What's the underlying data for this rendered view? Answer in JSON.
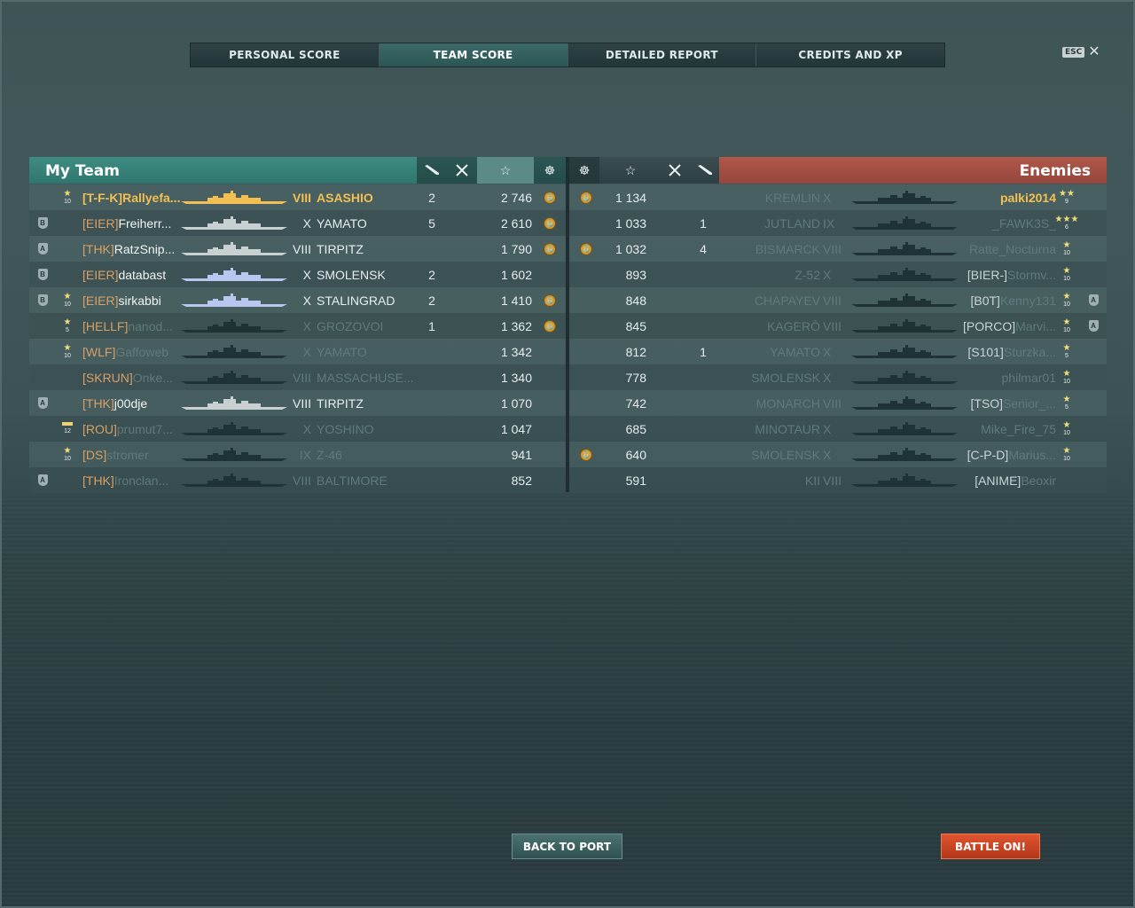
{
  "tabs": [
    {
      "label": "PERSONAL SCORE",
      "active": false
    },
    {
      "label": "TEAM SCORE",
      "active": true
    },
    {
      "label": "DETAILED REPORT",
      "active": false
    },
    {
      "label": "CREDITS AND XP",
      "active": false
    }
  ],
  "esc": {
    "key": "ESC",
    "close": "✕"
  },
  "my_team": {
    "title": "My Team",
    "header_icons": [
      "torpedo-icon",
      "planes-shot-icon",
      "star-icon",
      "anchor-medal-icon"
    ]
  },
  "enemies": {
    "title": "Enemies",
    "header_icons": [
      "anchor-medal-icon",
      "star-icon",
      "planes-shot-icon",
      "torpedo-icon"
    ]
  },
  "rows": [
    {
      "left": {
        "badge": "",
        "rank": "10",
        "rank_type": "star",
        "clan": "[T-F-K]",
        "player": "Rallyefa...",
        "player_dim": false,
        "tier": "VIII",
        "ship": "ASASHIO",
        "ship_dim": false,
        "kills": "2",
        "exp": "2 746",
        "medal": true,
        "me": true,
        "silhouette": "#f2c052"
      },
      "right": {
        "medal": true,
        "exp": "1 134",
        "kills": "",
        "ship": "KREMLIN",
        "tier": "X",
        "clan": "",
        "player": "palki2014",
        "rank": "9",
        "rank_type": "stars2",
        "badge": ""
      }
    },
    {
      "left": {
        "badge": "B",
        "rank": "",
        "rank_type": "",
        "clan": "[EIER]",
        "player": "Freiherr...",
        "player_dim": false,
        "tier": "X",
        "ship": "YAMATO",
        "ship_dim": false,
        "kills": "5",
        "exp": "2 610",
        "medal": true,
        "me": false,
        "silhouette": "#c8d0d2"
      },
      "right": {
        "medal": false,
        "exp": "1 033",
        "kills": "1",
        "ship": "JUTLAND",
        "tier": "IX",
        "clan": "",
        "player": "_FAWK3S_",
        "rank": "6",
        "rank_type": "stars3",
        "badge": ""
      }
    },
    {
      "left": {
        "badge": "A",
        "rank": "",
        "rank_type": "",
        "clan": "[THK]",
        "player": "RatzSnip...",
        "player_dim": false,
        "tier": "VIII",
        "ship": "TIRPITZ",
        "ship_dim": false,
        "kills": "",
        "exp": "1 790",
        "medal": true,
        "me": false,
        "silhouette": "#c8d0d2"
      },
      "right": {
        "medal": true,
        "exp": "1 032",
        "kills": "4",
        "ship": "BISMARCK",
        "tier": "VIII",
        "clan": "",
        "player": "Ratte_Nocturna",
        "rank": "10",
        "rank_type": "star",
        "badge": ""
      }
    },
    {
      "left": {
        "badge": "B",
        "rank": "",
        "rank_type": "",
        "clan": "[EIER]",
        "player": "databast",
        "player_dim": false,
        "tier": "X",
        "ship": "SMOLENSK",
        "ship_dim": false,
        "kills": "2",
        "exp": "1 602",
        "medal": false,
        "me": false,
        "silhouette": "#b9c6f0"
      },
      "right": {
        "medal": false,
        "exp": "893",
        "kills": "",
        "ship": "Z-52",
        "tier": "X",
        "clan": "[BIER-]",
        "player": "Stormv...",
        "rank": "10",
        "rank_type": "star",
        "badge": ""
      }
    },
    {
      "left": {
        "badge": "B",
        "rank": "10",
        "rank_type": "star",
        "clan": "[EIER]",
        "player": "sirkabbi",
        "player_dim": false,
        "tier": "X",
        "ship": "STALINGRAD",
        "ship_dim": false,
        "kills": "2",
        "exp": "1 410",
        "medal": true,
        "me": false,
        "silhouette": "#b9c6f0"
      },
      "right": {
        "medal": false,
        "exp": "848",
        "kills": "",
        "ship": "CHAPAYEV",
        "tier": "VIII",
        "clan": "[B0T]",
        "player": "Kenny131",
        "rank": "10",
        "rank_type": "star",
        "badge": "A"
      }
    },
    {
      "left": {
        "badge": "",
        "rank": "5",
        "rank_type": "star",
        "clan": "[HELLF]",
        "player": "nanod...",
        "player_dim": true,
        "tier": "X",
        "ship": "GROZOVOI",
        "ship_dim": true,
        "kills": "1",
        "exp": "1 362",
        "medal": true,
        "me": false,
        "silhouette": "#1f3236"
      },
      "right": {
        "medal": false,
        "exp": "845",
        "kills": "",
        "ship": "KAGERŌ",
        "tier": "VIII",
        "clan": "[PORCO]",
        "player": "Marvi...",
        "rank": "10",
        "rank_type": "star",
        "badge": "A"
      }
    },
    {
      "left": {
        "badge": "",
        "rank": "10",
        "rank_type": "star",
        "clan": "[WLF]",
        "player": "Gaffoweb",
        "player_dim": true,
        "tier": "X",
        "ship": "YAMATO",
        "ship_dim": true,
        "kills": "",
        "exp": "1 342",
        "medal": false,
        "me": false,
        "silhouette": "#1f3236"
      },
      "right": {
        "medal": false,
        "exp": "812",
        "kills": "1",
        "ship": "YAMATO",
        "tier": "X",
        "clan": "[S101]",
        "player": "Sturzka...",
        "rank": "5",
        "rank_type": "star",
        "badge": ""
      }
    },
    {
      "left": {
        "badge": "",
        "rank": "",
        "rank_type": "",
        "clan": "[SKRUN]",
        "player": "Onke...",
        "player_dim": true,
        "tier": "VIII",
        "ship": "MASSACHUSE...",
        "ship_dim": true,
        "kills": "",
        "exp": "1 340",
        "medal": false,
        "me": false,
        "silhouette": "#1f3236"
      },
      "right": {
        "medal": false,
        "exp": "778",
        "kills": "",
        "ship": "SMOLENSK",
        "tier": "X",
        "clan": "",
        "player": "philmar01",
        "rank": "10",
        "rank_type": "star",
        "badge": ""
      }
    },
    {
      "left": {
        "badge": "A",
        "rank": "",
        "rank_type": "",
        "clan": "[THK]",
        "player": "j00dje",
        "player_dim": false,
        "tier": "VIII",
        "ship": "TIRPITZ",
        "ship_dim": false,
        "kills": "",
        "exp": "1 070",
        "medal": false,
        "me": false,
        "silhouette": "#c8d0d2"
      },
      "right": {
        "medal": false,
        "exp": "742",
        "kills": "",
        "ship": "MONARCH",
        "tier": "VIII",
        "clan": "[TSO]",
        "player": "Senior_...",
        "rank": "5",
        "rank_type": "star",
        "badge": ""
      }
    },
    {
      "left": {
        "badge": "",
        "rank": "12",
        "rank_type": "bar",
        "clan": "[ROU]",
        "player": "prumut7...",
        "player_dim": true,
        "tier": "X",
        "ship": "YOSHINO",
        "ship_dim": true,
        "kills": "",
        "exp": "1 047",
        "medal": false,
        "me": false,
        "silhouette": "#1f3236"
      },
      "right": {
        "medal": false,
        "exp": "685",
        "kills": "",
        "ship": "MINOTAUR",
        "tier": "X",
        "clan": "",
        "player": "Mike_Fire_75",
        "rank": "10",
        "rank_type": "star",
        "badge": ""
      }
    },
    {
      "left": {
        "badge": "",
        "rank": "10",
        "rank_type": "star",
        "clan": "[DS]",
        "player": "stromer",
        "player_dim": true,
        "tier": "IX",
        "ship": "Z-46",
        "ship_dim": true,
        "kills": "",
        "exp": "941",
        "medal": false,
        "me": false,
        "silhouette": "#1f3236"
      },
      "right": {
        "medal": true,
        "exp": "640",
        "kills": "",
        "ship": "SMOLENSK",
        "tier": "X",
        "clan": "[C-P-D]",
        "player": "Marius...",
        "rank": "10",
        "rank_type": "star",
        "badge": ""
      }
    },
    {
      "left": {
        "badge": "A",
        "rank": "",
        "rank_type": "",
        "clan": "[THK]",
        "player": "Ironclan...",
        "player_dim": true,
        "tier": "VIII",
        "ship": "BALTIMORE",
        "ship_dim": true,
        "kills": "",
        "exp": "852",
        "medal": false,
        "me": false,
        "silhouette": "#1f3236"
      },
      "right": {
        "medal": false,
        "exp": "591",
        "kills": "",
        "ship": "KII",
        "tier": "VIII",
        "clan": "[ANIME]",
        "player": "Beoxir",
        "rank": "",
        "rank_type": "",
        "badge": ""
      }
    }
  ],
  "buttons": {
    "back_to_port": "BACK TO PORT",
    "battle_on": "BATTLE ON!"
  },
  "colors": {
    "accent_team": "#3f8c82",
    "accent_enemy": "#b0584a",
    "player_gold": "#f2c052",
    "clan_orange": "#d8a066"
  }
}
